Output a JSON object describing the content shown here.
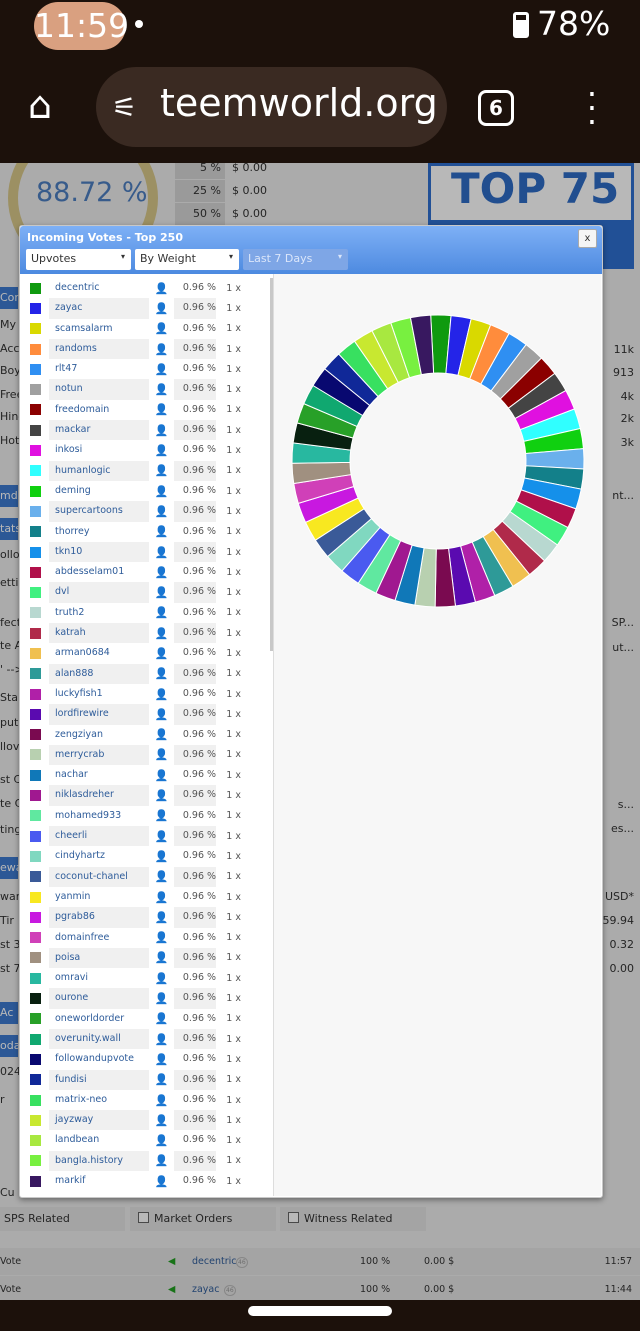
{
  "status_bar": {
    "time": "11:59",
    "battery": "78%"
  },
  "browser": {
    "url": "teemworld.org",
    "tab_count": "6"
  },
  "background": {
    "gauge_value": "88.72 %",
    "vote_table": [
      {
        "pct": "5 %",
        "val": "$ 0.00"
      },
      {
        "pct": "25 %",
        "val": "$ 0.00"
      },
      {
        "pct": "50 %",
        "val": "$ 0.00"
      }
    ],
    "rank_badge": "TOP 75",
    "left_fragments": [
      "Cor",
      "My C",
      "Acco",
      "Boyl",
      "Free",
      "Hind",
      "Hot",
      "mdi",
      "tats",
      "ollo",
      "etti",
      "fect",
      "te A",
      "' -->",
      "Sta",
      "put",
      "llov",
      "st C",
      "te C",
      "ting",
      "ewa",
      "war",
      "Tir",
      "st 3",
      "st 7",
      "Ac",
      "oda",
      "024",
      "r",
      "Cu"
    ],
    "right_fragments": [
      "11k",
      "913",
      "4k",
      "2k",
      "3k",
      "nt...",
      "SP...",
      "ut...",
      "s...",
      "es...",
      "l USD*",
      "59.94",
      "0.32",
      "0.00"
    ],
    "filters": [
      "SPS Related",
      "Market Orders",
      "Witness Related"
    ],
    "activity": [
      {
        "type": "Vote",
        "user": "decentric",
        "rep": "46",
        "weight": "100 %",
        "value": "0.00 $",
        "time": "11:57"
      },
      {
        "type": "Vote",
        "user": "zayac",
        "rep": "46",
        "weight": "100 %",
        "value": "0.00 $",
        "time": "11:44"
      }
    ]
  },
  "modal": {
    "title": "Incoming Votes - Top 250",
    "close_label": "x",
    "filters": {
      "type": "Upvotes",
      "sort": "By Weight",
      "period": "Last 7 Days"
    }
  },
  "chart_data": {
    "type": "pie",
    "donut": true,
    "entries": [
      {
        "name": "decentric",
        "pct": "0.96 %",
        "count": "1 x",
        "value": 0.96,
        "color": "#0f9a0f"
      },
      {
        "name": "zayac",
        "pct": "0.96 %",
        "count": "1 x",
        "value": 0.96,
        "color": "#2424e8"
      },
      {
        "name": "scamsalarm",
        "pct": "0.96 %",
        "count": "1 x",
        "value": 0.96,
        "color": "#d9d900"
      },
      {
        "name": "randoms",
        "pct": "0.96 %",
        "count": "1 x",
        "value": 0.96,
        "color": "#ff8c3c"
      },
      {
        "name": "rlt47",
        "pct": "0.96 %",
        "count": "1 x",
        "value": 0.96,
        "color": "#2f8ff2"
      },
      {
        "name": "notun",
        "pct": "0.96 %",
        "count": "1 x",
        "value": 0.96,
        "color": "#a0a0a0"
      },
      {
        "name": "freedomain",
        "pct": "0.96 %",
        "count": "1 x",
        "value": 0.96,
        "color": "#8b0000"
      },
      {
        "name": "mackar",
        "pct": "0.96 %",
        "count": "1 x",
        "value": 0.96,
        "color": "#444444"
      },
      {
        "name": "inkosi",
        "pct": "0.96 %",
        "count": "1 x",
        "value": 0.96,
        "color": "#e010e0"
      },
      {
        "name": "humanlogic",
        "pct": "0.96 %",
        "count": "1 x",
        "value": 0.96,
        "color": "#30ffff"
      },
      {
        "name": "deming",
        "pct": "0.96 %",
        "count": "1 x",
        "value": 0.96,
        "color": "#10d010"
      },
      {
        "name": "supercartoons",
        "pct": "0.96 %",
        "count": "1 x",
        "value": 0.96,
        "color": "#6ab0ec"
      },
      {
        "name": "thorrey",
        "pct": "0.96 %",
        "count": "1 x",
        "value": 0.96,
        "color": "#13808a"
      },
      {
        "name": "tkn10",
        "pct": "0.96 %",
        "count": "1 x",
        "value": 0.96,
        "color": "#1590ea"
      },
      {
        "name": "abdesselam01",
        "pct": "0.96 %",
        "count": "1 x",
        "value": 0.96,
        "color": "#b0104a"
      },
      {
        "name": "dvl",
        "pct": "0.96 %",
        "count": "1 x",
        "value": 0.96,
        "color": "#40f080"
      },
      {
        "name": "truth2",
        "pct": "0.96 %",
        "count": "1 x",
        "value": 0.96,
        "color": "#b8d8d0"
      },
      {
        "name": "katrah",
        "pct": "0.96 %",
        "count": "1 x",
        "value": 0.96,
        "color": "#b02a4a"
      },
      {
        "name": "arman0684",
        "pct": "0.96 %",
        "count": "1 x",
        "value": 0.96,
        "color": "#f0c050"
      },
      {
        "name": "alan888",
        "pct": "0.96 %",
        "count": "1 x",
        "value": 0.96,
        "color": "#2e9a98"
      },
      {
        "name": "luckyfish1",
        "pct": "0.96 %",
        "count": "1 x",
        "value": 0.96,
        "color": "#b020a8"
      },
      {
        "name": "lordfirewire",
        "pct": "0.96 %",
        "count": "1 x",
        "value": 0.96,
        "color": "#5a0ab0"
      },
      {
        "name": "zengziyan",
        "pct": "0.96 %",
        "count": "1 x",
        "value": 0.96,
        "color": "#7a0a50"
      },
      {
        "name": "merrycrab",
        "pct": "0.96 %",
        "count": "1 x",
        "value": 0.96,
        "color": "#b8d0b0"
      },
      {
        "name": "nachar",
        "pct": "0.96 %",
        "count": "1 x",
        "value": 0.96,
        "color": "#1078b8"
      },
      {
        "name": "niklasdreher",
        "pct": "0.96 %",
        "count": "1 x",
        "value": 0.96,
        "color": "#a01890"
      },
      {
        "name": "mohamed933",
        "pct": "0.96 %",
        "count": "1 x",
        "value": 0.96,
        "color": "#60e8a0"
      },
      {
        "name": "cheerli",
        "pct": "0.96 %",
        "count": "1 x",
        "value": 0.96,
        "color": "#4a5af0"
      },
      {
        "name": "cindyhartz",
        "pct": "0.96 %",
        "count": "1 x",
        "value": 0.96,
        "color": "#80d8c0"
      },
      {
        "name": "coconut-chanel",
        "pct": "0.96 %",
        "count": "1 x",
        "value": 0.96,
        "color": "#3a5a98"
      },
      {
        "name": "yanmin",
        "pct": "0.96 %",
        "count": "1 x",
        "value": 0.96,
        "color": "#f8e820"
      },
      {
        "name": "pgrab86",
        "pct": "0.96 %",
        "count": "1 x",
        "value": 0.96,
        "color": "#c818e0"
      },
      {
        "name": "domainfree",
        "pct": "0.96 %",
        "count": "1 x",
        "value": 0.96,
        "color": "#d040b8"
      },
      {
        "name": "poisa",
        "pct": "0.96 %",
        "count": "1 x",
        "value": 0.96,
        "color": "#a09080"
      },
      {
        "name": "omravi",
        "pct": "0.96 %",
        "count": "1 x",
        "value": 0.96,
        "color": "#28b8a0"
      },
      {
        "name": "ourone",
        "pct": "0.96 %",
        "count": "1 x",
        "value": 0.96,
        "color": "#082010"
      },
      {
        "name": "oneworldorder",
        "pct": "0.96 %",
        "count": "1 x",
        "value": 0.96,
        "color": "#28a028"
      },
      {
        "name": "overunity.wall",
        "pct": "0.96 %",
        "count": "1 x",
        "value": 0.96,
        "color": "#10a870"
      },
      {
        "name": "followandupvote",
        "pct": "0.96 %",
        "count": "1 x",
        "value": 0.96,
        "color": "#080870"
      },
      {
        "name": "fundisi",
        "pct": "0.96 %",
        "count": "1 x",
        "value": 0.96,
        "color": "#102898"
      },
      {
        "name": "matrix-neo",
        "pct": "0.96 %",
        "count": "1 x",
        "value": 0.96,
        "color": "#38e060"
      },
      {
        "name": "jayzway",
        "pct": "0.96 %",
        "count": "1 x",
        "value": 0.96,
        "color": "#c8e830"
      },
      {
        "name": "landbean",
        "pct": "0.96 %",
        "count": "1 x",
        "value": 0.96,
        "color": "#a8e840"
      },
      {
        "name": "bangla.history",
        "pct": "0.96 %",
        "count": "1 x",
        "value": 0.96,
        "color": "#78f040"
      },
      {
        "name": "markif",
        "pct": "0.96 %",
        "count": "1 x",
        "value": 0.96,
        "color": "#381860"
      }
    ]
  }
}
